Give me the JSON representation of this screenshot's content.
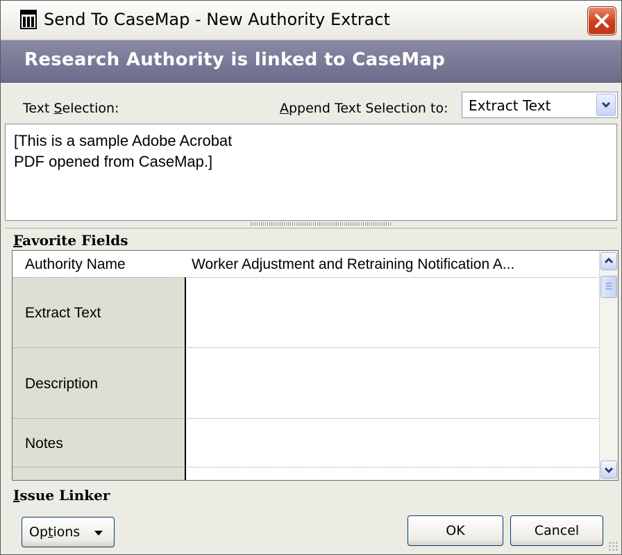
{
  "window": {
    "title": "Send To CaseMap - New Authority Extract",
    "close_icon": "close-icon",
    "app_icon": "casemap-app-icon"
  },
  "banner": {
    "text": "Research Authority is linked to CaseMap"
  },
  "text_selection": {
    "label_pre": "Text ",
    "label_mnemonic": "S",
    "label_post": "election:",
    "append_label_mnemonic": "A",
    "append_label_post": "ppend Text Selection to:",
    "append_value": "Extract Text",
    "content": "[This is a sample Adobe Acrobat PDF opened from CaseMap.]"
  },
  "favorite_fields": {
    "heading_mnemonic": "F",
    "heading_post": "avorite Fields",
    "rows": [
      {
        "label": "Authority Name",
        "value": "Worker Adjustment and Retraining Notification A..."
      },
      {
        "label": "Extract Text",
        "value": ""
      },
      {
        "label": "Description",
        "value": ""
      },
      {
        "label": "Notes",
        "value": ""
      }
    ]
  },
  "issue_linker": {
    "heading_mnemonic": "I",
    "heading_post": "ssue Linker"
  },
  "buttons": {
    "options_pre": "Op",
    "options_mnemonic": "t",
    "options_post": "ions",
    "ok": "OK",
    "cancel": "Cancel"
  },
  "colors": {
    "banner": "#7a7a98",
    "close": "#cc3d1b",
    "dialog_bg": "#ecebe4"
  }
}
